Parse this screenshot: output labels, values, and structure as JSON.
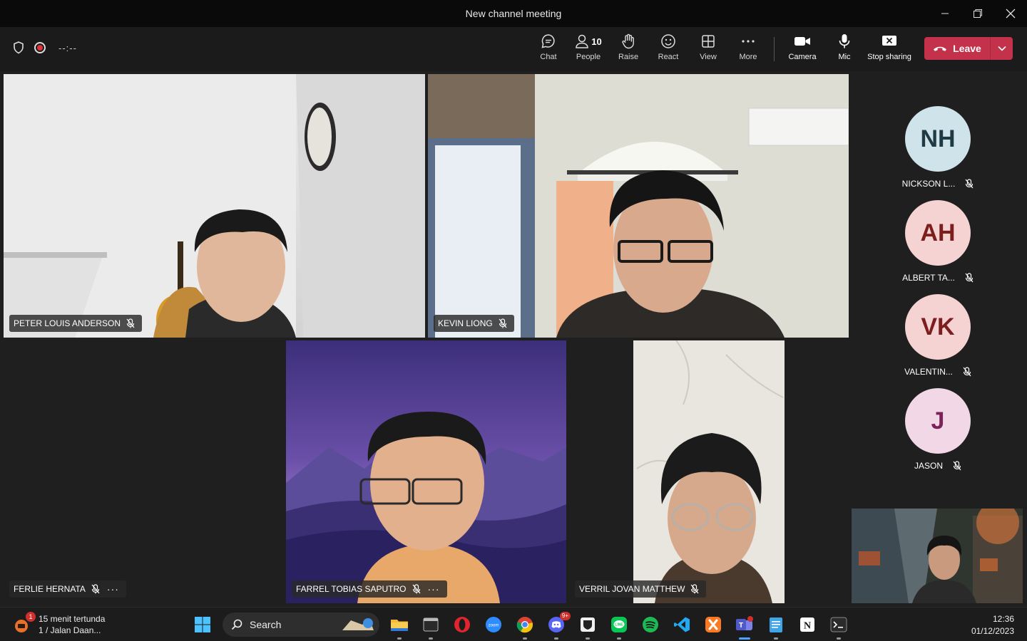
{
  "window": {
    "title": "New channel meeting"
  },
  "toolbar": {
    "timer": "--:--",
    "chat_label": "Chat",
    "people_label": "People",
    "people_count": "10",
    "raise_label": "Raise",
    "react_label": "React",
    "view_label": "View",
    "more_label": "More",
    "camera_label": "Camera",
    "mic_label": "Mic",
    "stop_sharing_label": "Stop sharing",
    "leave_label": "Leave",
    "leave_color": "#c4314b"
  },
  "participants": [
    {
      "name": "PETER LOUIS ANDERSON"
    },
    {
      "name": "KEVIN LIONG"
    },
    {
      "name": "FERLIE HERNATA"
    },
    {
      "name": "FARREL TOBIAS SAPUTRO"
    },
    {
      "name": "VERRIL JOVAN MATTHEW"
    }
  ],
  "roster": [
    {
      "initials": "NH",
      "name": "NICKSON L...",
      "bg": "#cfe3ea",
      "fg": "#1f3a44"
    },
    {
      "initials": "AH",
      "name": "ALBERT TA...",
      "bg": "#f6d3d3",
      "fg": "#7a1e1e"
    },
    {
      "initials": "VK",
      "name": "VALENTIN...",
      "bg": "#f6d3d3",
      "fg": "#7a1e1e"
    },
    {
      "initials": "J",
      "name": "JASON",
      "bg": "#f2d7e6",
      "fg": "#7a2358"
    }
  ],
  "taskbar": {
    "weather_line1": "15 menit tertunda",
    "weather_line2": "1 / Jalan Daan...",
    "weather_badge": "1",
    "search_label": "Search",
    "discord_badge": "9+",
    "time": "12:36",
    "date": "01/12/2023"
  }
}
